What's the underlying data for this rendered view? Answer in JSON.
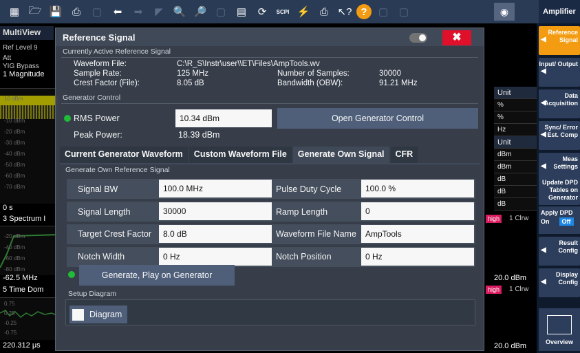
{
  "toolbar": {
    "app_title": "Amplifier",
    "icons": [
      "grid-icon",
      "folder-icon",
      "save-icon",
      "print-icon",
      "blank-icon",
      "undo-icon",
      "redo-icon",
      "marker-icon",
      "zoom-icon",
      "zoom-mult-icon",
      "blank2-icon",
      "window-icon",
      "restore-icon",
      "scpi-icon",
      "blank3-icon",
      "sequence-icon",
      "context-help-icon",
      "help-icon",
      "addwin1-icon",
      "addwin2-icon"
    ],
    "scpi_label": "SCPI",
    "help_label": "?",
    "camera_icon": "camera-icon"
  },
  "softkeys": [
    {
      "label": "Reference Signal",
      "active": true
    },
    {
      "label": "Input/ Output",
      "active": false
    },
    {
      "label": "Data Acquisition",
      "active": false
    },
    {
      "label": "Sync/ Error Est. Comp",
      "active": false
    },
    {
      "label": "Meas Settings",
      "active": false
    },
    {
      "label": "Update DPD Tables on Generator",
      "active": false
    },
    {
      "label": "Result Config",
      "active": false
    },
    {
      "label": "Display Config",
      "active": false
    }
  ],
  "apply_dpd": {
    "label": "Apply DPD",
    "on": "On",
    "off": "Off"
  },
  "overview": {
    "label": "Overview"
  },
  "background": {
    "tab": "MultiView",
    "ref_level": "Ref Level 9",
    "att": "Att",
    "yig": "YIG Bypass",
    "win1": "1 Magnitude",
    "win3": "3 Spectrum I",
    "win5": "5 Time Dom",
    "t0": "0 s",
    "freq": "-62.5 MHz",
    "time_end": "220.312 μs",
    "ref_a": "20.0 dBm",
    "ref_b": "20.0 dBm",
    "high": "high",
    "clrw": "1 Clrw",
    "units": [
      "Unit",
      "%",
      "%",
      "Hz",
      "Unit",
      "dBm",
      "dBm",
      "dB",
      "dB",
      "dB"
    ],
    "axis1": [
      "10 dBm",
      "0 dBm",
      "-10 dBm",
      "-20 dBm",
      "-30 dBm",
      "-40 dBm",
      "-50 dBm",
      "-60 dBm",
      "-70 dBm"
    ],
    "axis3": [
      "-20 dBm",
      "-40 dBm",
      "-60 dBm",
      "-80 dBm"
    ],
    "axis5": [
      "0.75",
      "0.25",
      "-0.25",
      "-0.75"
    ]
  },
  "dialog": {
    "title": "Reference Signal",
    "close": "✖",
    "active_section": "Currently Active Reference Signal",
    "waveform_file_label": "Waveform File:",
    "waveform_file": "C:\\R_S\\Instr\\user\\\\ET\\Files\\AmpTools.wv",
    "sample_rate_label": "Sample Rate:",
    "sample_rate": "125 MHz",
    "num_samples_label": "Number of Samples:",
    "num_samples": "30000",
    "crest_label": "Crest Factor (File):",
    "crest": "8.05 dB",
    "bandwidth_label": "Bandwidth (OBW):",
    "bandwidth": "91.21 MHz",
    "gen_section": "Generator Control",
    "rms_label": "RMS Power",
    "rms_value": "10.34 dBm",
    "open_gen": "Open Generator Control",
    "peak_label": "Peak Power:",
    "peak_value": "18.39 dBm",
    "tabs": [
      "Current Generator Waveform",
      "Custom Waveform File",
      "Generate Own Signal",
      "CFR"
    ],
    "own_section": "Generate Own Reference Signal",
    "signal_bw_label": "Signal BW",
    "signal_bw": "100.0 MHz",
    "pulse_duty_label": "Pulse Duty Cycle",
    "pulse_duty": "100.0 %",
    "signal_length_label": "Signal Length",
    "signal_length": "30000",
    "ramp_length_label": "Ramp Length",
    "ramp_length": "0",
    "target_crest_label": "Target Crest Factor",
    "target_crest": "8.0 dB",
    "wv_name_label": "Waveform File Name",
    "wv_name": "AmpTools",
    "notch_width_label": "Notch Width",
    "notch_width": "0 Hz",
    "notch_pos_label": "Notch Position",
    "notch_pos": "0 Hz",
    "generate_btn": "Generate, Play on Generator",
    "setup_section": "Setup Diagram",
    "diagram_btn": "Diagram"
  }
}
